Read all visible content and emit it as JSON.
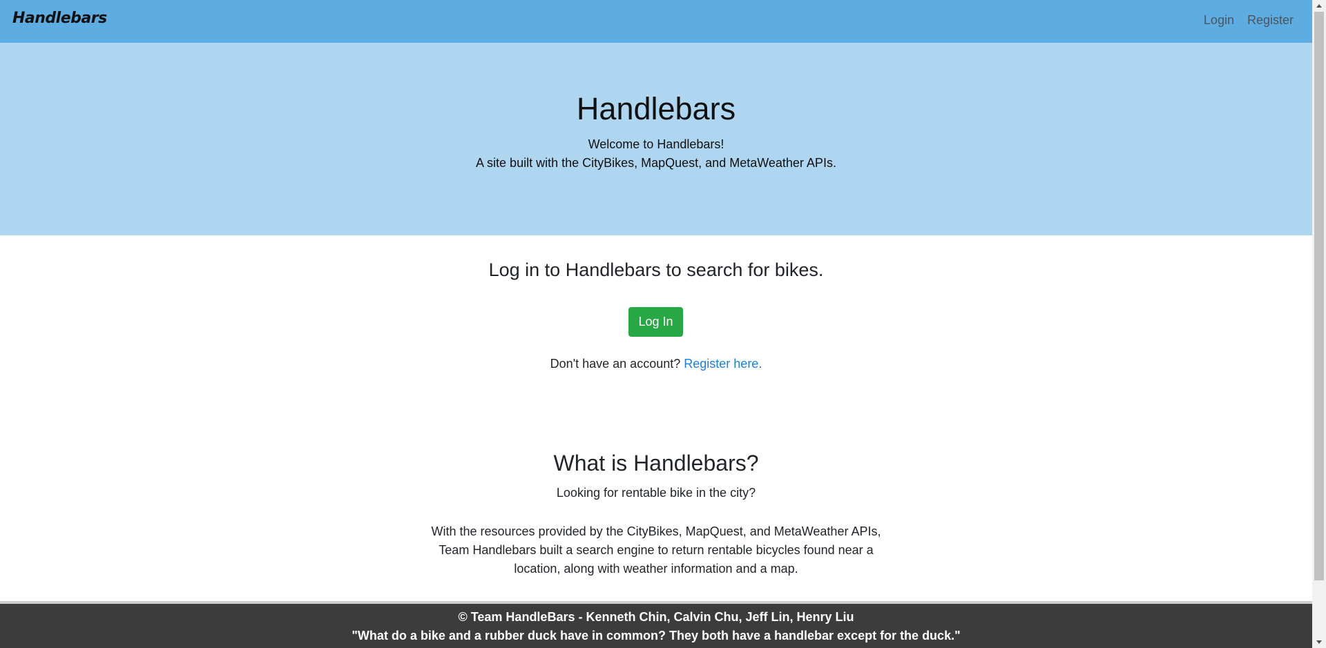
{
  "navbar": {
    "brand": "Handlebars",
    "links": [
      {
        "label": "Login"
      },
      {
        "label": "Register"
      }
    ]
  },
  "hero": {
    "title": "Handlebars",
    "line1": "Welcome to Handlebars!",
    "line2": "A site built with the CityBikes, MapQuest, and MetaWeather APIs."
  },
  "login": {
    "heading": "Log in to Handlebars to search for bikes.",
    "button_label": "Log In",
    "register_prompt": "Don't have an account?",
    "register_link": "Register here."
  },
  "about": {
    "heading": "What is Handlebars?",
    "subheading": "Looking for rentable bike in the city?",
    "body": "With the resources provided by the CityBikes, MapQuest, and MetaWeather APIs, Team Handlebars built a search engine to return rentable bicycles found near a location, along with weather information and a map."
  },
  "footer": {
    "credits": "© Team HandleBars - Kenneth Chin, Calvin Chu, Jeff Lin, Henry Liu",
    "quote": "\"What do a bike and a rubber duck have in common? They both have a handlebar except for the duck.\""
  },
  "colors": {
    "navbar": "#5dade2",
    "hero": "#aed6f1",
    "button": "#28a745",
    "link": "#1a7fe0",
    "footer": "#3c3c3c"
  },
  "icons": {
    "scroll_up": "triangle-up-icon",
    "scroll_down": "triangle-down-icon"
  }
}
